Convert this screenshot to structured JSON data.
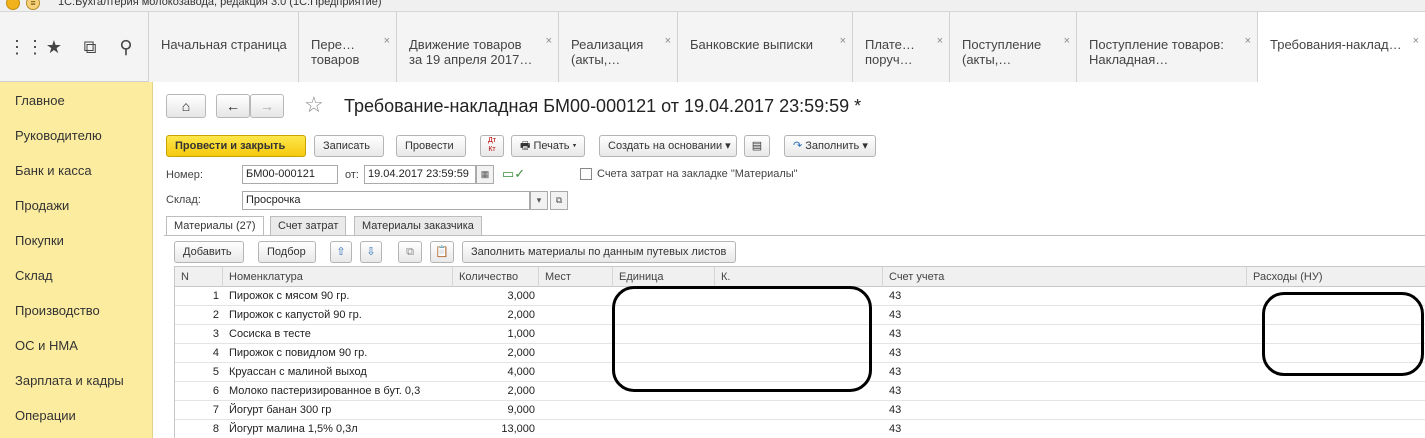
{
  "window": {
    "title": "1С:Бухгалтерия молокозавода, редакция 3.0  (1С:Предприятие)"
  },
  "quick_icons": [
    "apps-icon",
    "star-icon",
    "history-icon",
    "search-icon"
  ],
  "tabs": [
    {
      "label": "Начальная страница",
      "closable": false
    },
    {
      "label": "Пере…\nтоваров",
      "closable": true
    },
    {
      "label": "Движение товаров\nза 19 апреля 2017…",
      "closable": true
    },
    {
      "label": "Реализация\n(акты,…",
      "closable": true
    },
    {
      "label": "Банковские выписки",
      "closable": true
    },
    {
      "label": "Плате…\nпоруч…",
      "closable": true
    },
    {
      "label": "Поступление\n(акты,…",
      "closable": true
    },
    {
      "label": "Поступление товаров:\nНакладная…",
      "closable": true
    },
    {
      "label": "Требования-наклад…",
      "closable": true
    }
  ],
  "sidebar": {
    "items": [
      "Главное",
      "Руководителю",
      "Банк и касса",
      "Продажи",
      "Покупки",
      "Склад",
      "Производство",
      "ОС и НМА",
      "Зарплата и кадры",
      "Операции"
    ]
  },
  "document": {
    "title": "Требование-накладная БМ00-000121 от 19.04.2017 23:59:59 *",
    "toolbar": {
      "post_close": "Провести и закрыть",
      "save": "Записать",
      "post": "Провести",
      "dtkt": "Дт\nКт",
      "print": "Печать",
      "create_based": "Создать на основании",
      "fill": "Заполнить"
    },
    "number_label": "Номер:",
    "number_value": "БМ00-000121",
    "date_label": "от:",
    "date_value": "19.04.2017 23:59:59",
    "cost_accounts_label": "Счета затрат на закладке \"Материалы\"",
    "warehouse_label": "Склад:",
    "warehouse_value": "Просрочка"
  },
  "inner_tabs": [
    "Материалы (27)",
    "Счет затрат",
    "Материалы заказчика"
  ],
  "table_toolbar": {
    "add": "Добавить",
    "select": "Подбор",
    "fill_waybills": "Заполнить материалы по данным путевых листов"
  },
  "table": {
    "columns": [
      "N",
      "Номенклатура",
      "Количество",
      "Мест",
      "Единица",
      "К.",
      "Счет учета",
      "Расходы (НУ)"
    ],
    "rows": [
      {
        "n": "1",
        "name": "Пирожок с мясом 90 гр.",
        "qty": "3,000",
        "account": "43"
      },
      {
        "n": "2",
        "name": "Пирожок с капустой 90 гр.",
        "qty": "2,000",
        "account": "43"
      },
      {
        "n": "3",
        "name": "Сосиска в тесте",
        "qty": "1,000",
        "account": "43"
      },
      {
        "n": "4",
        "name": "Пирожок с повидлом 90 гр.",
        "qty": "2,000",
        "account": "43"
      },
      {
        "n": "5",
        "name": "Круассан с малиной выход",
        "qty": "4,000",
        "account": "43"
      },
      {
        "n": "6",
        "name": "Молоко пастеризированное в бут. 0,3",
        "qty": "2,000",
        "account": "43"
      },
      {
        "n": "7",
        "name": "Йогурт банан 300 гр",
        "qty": "9,000",
        "account": "43"
      },
      {
        "n": "8",
        "name": "Йогурт малина 1,5% 0,3л",
        "qty": "13,000",
        "account": "43"
      }
    ]
  }
}
